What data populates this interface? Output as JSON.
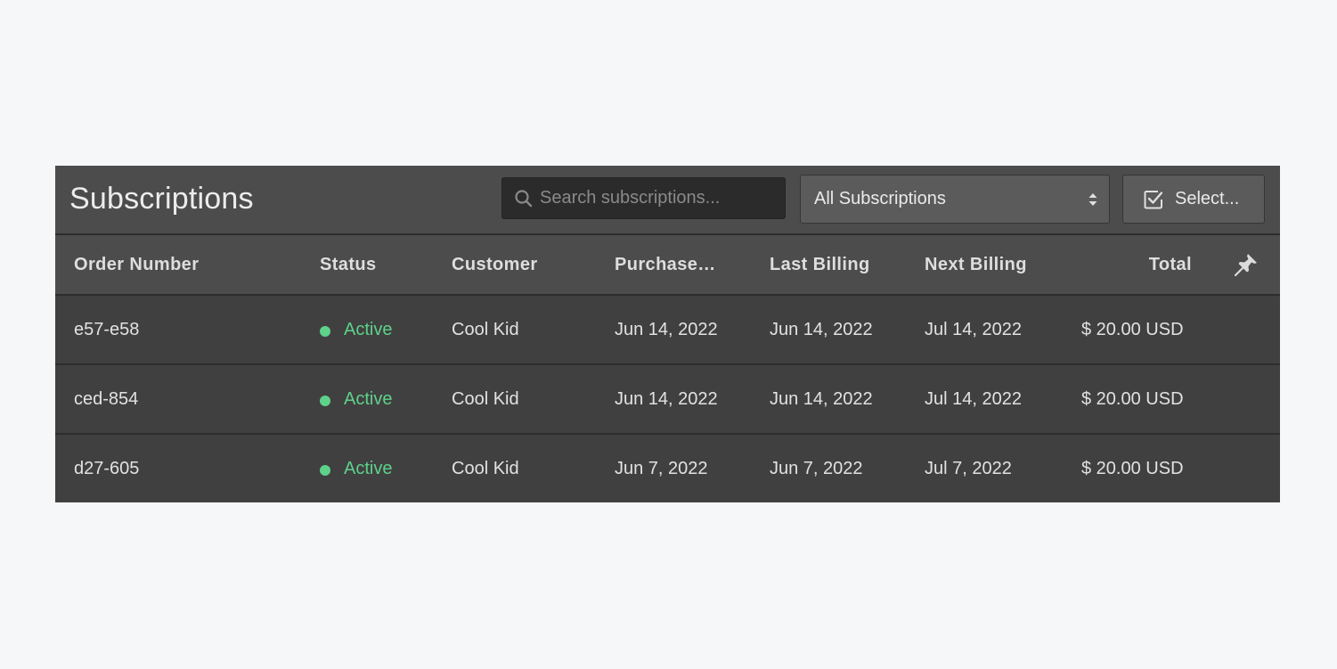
{
  "header": {
    "title": "Subscriptions",
    "search": {
      "placeholder": "Search subscriptions...",
      "value": "",
      "icon": "search-icon"
    },
    "filter_dropdown": {
      "selected": "All Subscriptions",
      "icon": "sort-arrows-icon"
    },
    "select_button": {
      "label": "Select...",
      "icon": "checkbox-checked-icon"
    }
  },
  "table": {
    "columns": {
      "order_number": "Order Number",
      "status": "Status",
      "customer": "Customer",
      "purchase": "Purchase…",
      "last_billing": "Last Billing",
      "next_billing": "Next Billing",
      "total": "Total",
      "pin_icon": "pin-icon"
    },
    "rows": [
      {
        "order_number": "e57-e58",
        "status": "Active",
        "customer": "Cool Kid",
        "purchase": "Jun 14, 2022",
        "last_billing": "Jun 14, 2022",
        "next_billing": "Jul 14, 2022",
        "total": "$ 20.00 USD"
      },
      {
        "order_number": "ced-854",
        "status": "Active",
        "customer": "Cool Kid",
        "purchase": "Jun 14, 2022",
        "last_billing": "Jun 14, 2022",
        "next_billing": "Jul 14, 2022",
        "total": "$ 20.00 USD"
      },
      {
        "order_number": "d27-605",
        "status": "Active",
        "customer": "Cool Kid",
        "purchase": "Jun 7, 2022",
        "last_billing": "Jun 7, 2022",
        "next_billing": "Jul 7, 2022",
        "total": "$ 20.00 USD"
      }
    ]
  },
  "colors": {
    "background": "#f6f7f9",
    "panel": "#404040",
    "header": "#4c4c4c",
    "divider": "#2d2d2d",
    "status_active": "#5ed18a",
    "text": "#e2e2e2"
  }
}
